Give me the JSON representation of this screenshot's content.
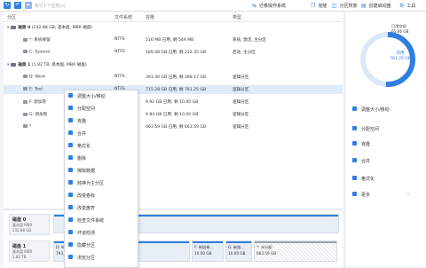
{
  "toolbar": {
    "left_buttons": [
      {
        "icon": "refresh-icon"
      },
      {
        "icon": "undo-icon"
      },
      {
        "icon": "execute-icon",
        "label": "执行1个任务(s)"
      }
    ],
    "right_buttons": [
      {
        "icon": "migrate-os-icon",
        "label": "迁移操作系统"
      },
      {
        "icon": "clone-icon",
        "label": "克隆"
      },
      {
        "icon": "recover-partition-icon",
        "label": "分区恢复"
      },
      {
        "icon": "bootable-media-icon",
        "label": "创建启动盘"
      },
      {
        "icon": "tools-icon",
        "label": "工具"
      }
    ]
  },
  "table": {
    "headers": [
      "分区",
      "文件系统",
      "容量",
      "类型"
    ],
    "rows": [
      {
        "kind": "disk",
        "name": "磁盘 0",
        "detail": "(232.88 GB, 基本盘, MBR 磁盘)",
        "fs": "",
        "capacity": "",
        "type": ""
      },
      {
        "kind": "part",
        "name": "*: 系统保留",
        "fs": "NTFS",
        "capacity": "516 MB    已用, 剩    549 MB",
        "type": "系统, 激活, 主分区"
      },
      {
        "kind": "part",
        "name": "C: System",
        "fs": "NTFS",
        "capacity": "189.08 GB 已用, 剩    232.35 GB",
        "type": "启动, 主分区"
      },
      {
        "kind": "disk",
        "name": "磁盘 1",
        "detail": "(1.82 TB, 基本盘, MBR 磁盘)",
        "fs": "",
        "capacity": "",
        "type": ""
      },
      {
        "kind": "part",
        "name": "D: Work",
        "fs": "NTFS",
        "capacity": "393.40 GB 已用, 剩    398.17 GB",
        "type": "逻辑分区"
      },
      {
        "kind": "part",
        "name": "E: Tool",
        "fs": "NTFS",
        "capacity": "715.28 GB 已用, 剩    781.25 GB",
        "type": "逻辑分区",
        "selected": true
      },
      {
        "kind": "part",
        "name": "F: 新加卷",
        "fs": "NTFS",
        "capacity": "9.92 GB   已用, 剩    10.00 GB",
        "type": "逻辑分区"
      },
      {
        "kind": "part",
        "name": "G: 新加卷",
        "fs": "NTFS",
        "capacity": "9.84 GB   已用, 剩    10.00 GB",
        "type": "逻辑分区"
      },
      {
        "kind": "part",
        "name": "*",
        "fs": "",
        "capacity": "663.59 GB 已用, 剩    663.59 GB",
        "type": "逻辑分区"
      }
    ]
  },
  "context_menu": {
    "items": [
      {
        "icon": "resize-icon",
        "label": "调整大小/移动"
      },
      {
        "icon": "allocate-icon",
        "label": "分配空间"
      },
      {
        "icon": "clone-icon",
        "label": "克隆"
      },
      {
        "icon": "merge-icon",
        "label": "合并"
      },
      {
        "icon": "format-icon",
        "label": "格式化"
      },
      {
        "icon": "delete-icon",
        "label": "删除"
      },
      {
        "icon": "wipe-icon",
        "label": "擦除数据"
      },
      {
        "icon": "convert-icon",
        "label": "转换为主分区"
      },
      {
        "icon": "label-icon",
        "label": "改变卷标"
      },
      {
        "icon": "drive-letter-icon",
        "label": "改变盘符"
      },
      {
        "icon": "check-icon",
        "label": "检查文件系统"
      },
      {
        "icon": "surface-test-icon",
        "label": "坏道检测"
      },
      {
        "icon": "hide-icon",
        "label": "隐藏分区"
      },
      {
        "icon": "explore-icon",
        "label": "浏览分区"
      }
    ]
  },
  "side_panel": {
    "usage_title": "已用空间",
    "usage_value": "65.66 GB",
    "free_label": "可用",
    "free_value": "781.25 GB",
    "ring_color": "#2f7fe0",
    "operations": [
      {
        "icon": "resize-icon",
        "label": "调整大小/移动"
      },
      {
        "icon": "allocate-icon",
        "label": "分配空间"
      },
      {
        "icon": "clone-icon",
        "label": "克隆"
      },
      {
        "icon": "merge-icon",
        "label": "合并"
      },
      {
        "icon": "format-icon",
        "label": "格式化"
      },
      {
        "icon": "more-icon",
        "label": "更多",
        "arrow": "›"
      }
    ]
  },
  "disk_map": {
    "disks": [
      {
        "name": "磁盘 0",
        "line1": "基本盘 MBR",
        "line2": "232.88 GB"
      },
      {
        "name": "磁盘 1",
        "line1": "基本盘 MBR",
        "line2": "1.82 TB"
      }
    ],
    "segments": [
      {
        "name": "D: Work ...",
        "size": "793.41 GB"
      },
      {
        "name": "F: 新加卷...",
        "size": "10.00 GB"
      },
      {
        "name": "G: 新加...",
        "size": "10.00 GB"
      },
      {
        "name": "*: 未分配",
        "size": "663.59 GB"
      }
    ]
  }
}
